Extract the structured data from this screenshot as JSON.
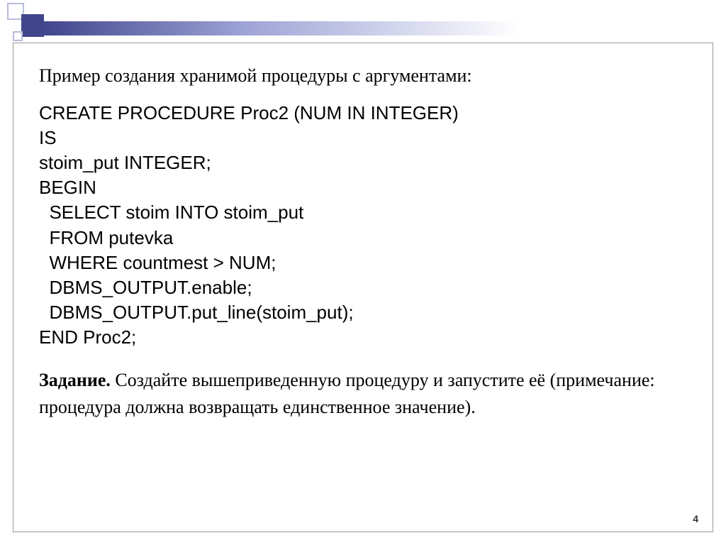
{
  "heading": "Пример создания хранимой процедуры с аргументами:",
  "code": "CREATE PROCEDURE Proc2 (NUM IN INTEGER)\nIS\nstoim_put INTEGER;\nBEGIN\n  SELECT stoim INTO stoim_put\n  FROM putevka\n  WHERE countmest > NUM;\n  DBMS_OUTPUT.enable;\n  DBMS_OUTPUT.put_line(stoim_put);\nEND Proc2;",
  "task_label": "Задание.",
  "task_text": " Создайте вышеприведенную процедуру и запустите её (примечание: процедура должна возвращать единственное значение).",
  "page_number": "4"
}
